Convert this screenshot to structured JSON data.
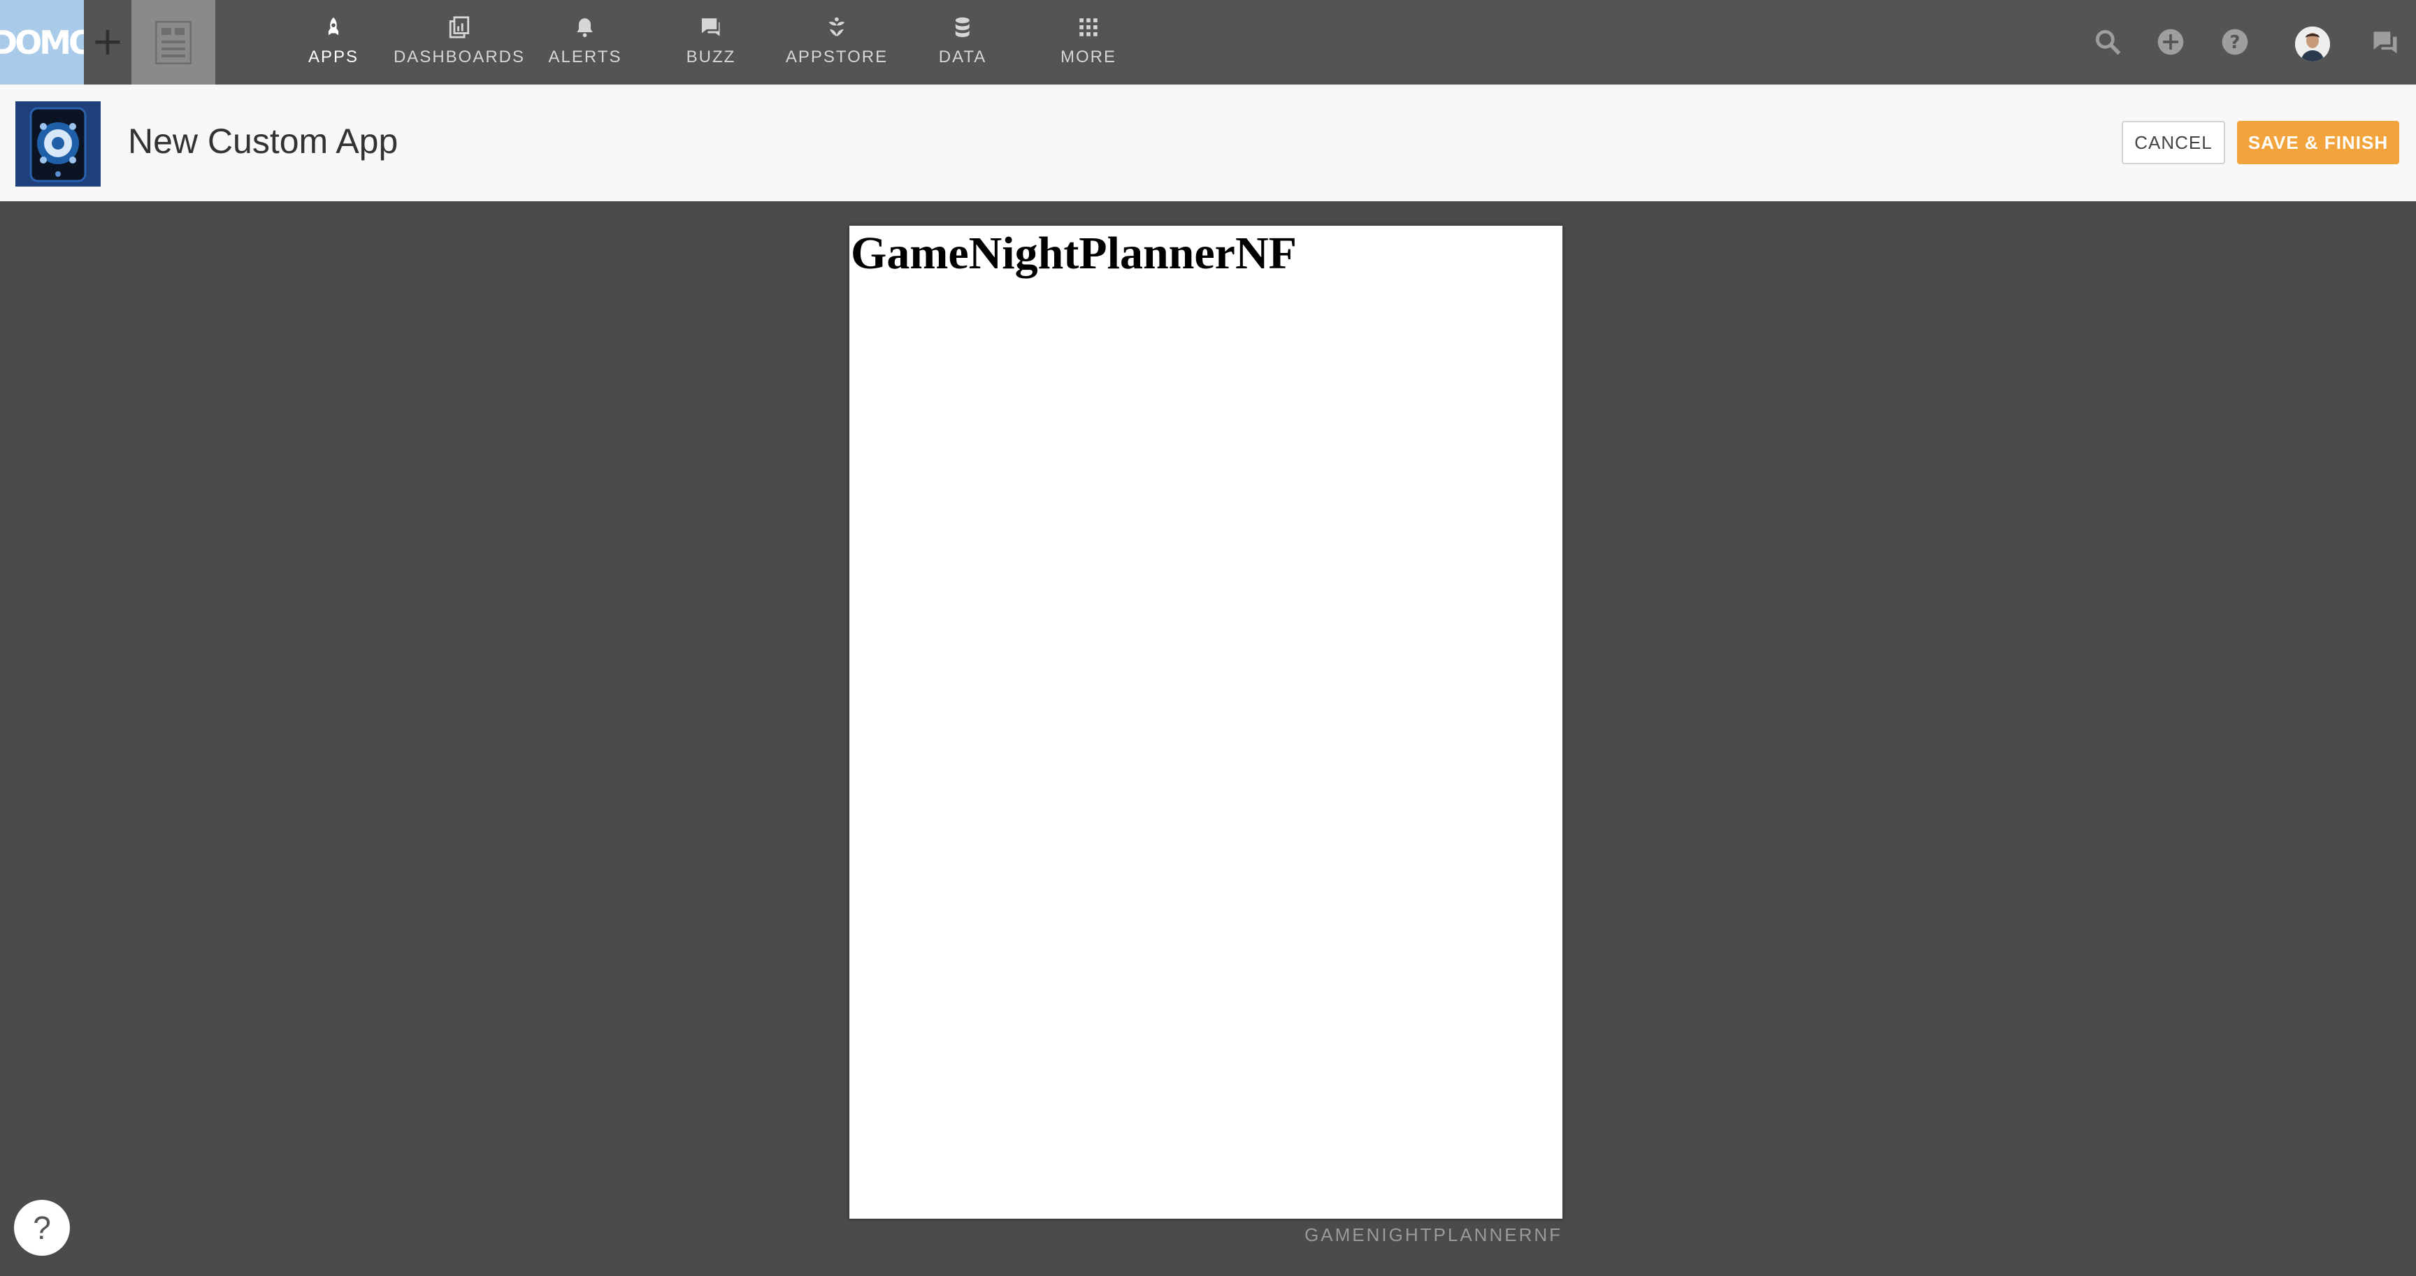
{
  "brand": {
    "logo_text": "DOMO"
  },
  "topbar": {
    "plus_label": "+",
    "nav": [
      {
        "label": "APPS",
        "icon": "rocket-icon",
        "active": true
      },
      {
        "label": "DASHBOARDS",
        "icon": "dashboard-icon"
      },
      {
        "label": "ALERTS",
        "icon": "bell-icon"
      },
      {
        "label": "BUZZ",
        "icon": "chat-icon"
      },
      {
        "label": "APPSTORE",
        "icon": "appstore-icon"
      },
      {
        "label": "DATA",
        "icon": "database-icon"
      },
      {
        "label": "MORE",
        "icon": "grid-icon"
      }
    ],
    "right_icons": [
      "search-icon",
      "add-circle-icon",
      "help-circle-icon",
      "avatar",
      "buzz-chat-icon"
    ]
  },
  "header": {
    "title": "New Custom App",
    "cancel_label": "CANCEL",
    "save_label": "SAVE & FINISH"
  },
  "canvas": {
    "heading": "GameNightPlannerNF",
    "card_name": "GAMENIGHTPLANNERNF"
  },
  "help": {
    "label": "?"
  },
  "colors": {
    "topbar": "#545454",
    "logo_bg": "#a9cbe9",
    "page_bg": "#4b4b4b",
    "accent": "#f2a33c"
  }
}
